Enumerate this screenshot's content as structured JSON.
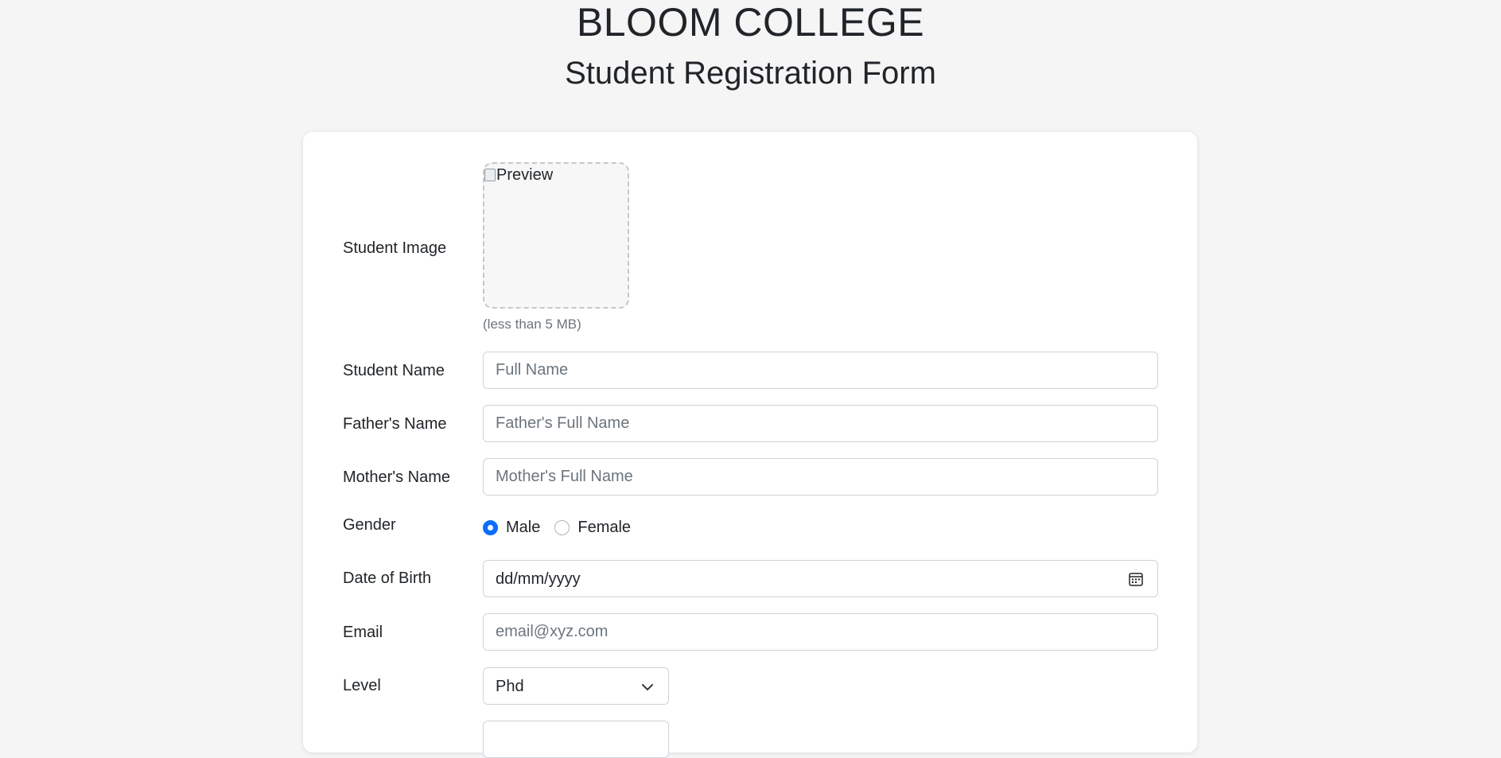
{
  "header": {
    "college": "BLOOM COLLEGE",
    "form_title": "Student Registration Form"
  },
  "form": {
    "image": {
      "label": "Student Image",
      "preview_alt": "Preview",
      "hint": "(less than 5 MB)"
    },
    "student_name": {
      "label": "Student Name",
      "placeholder": "Full Name",
      "value": ""
    },
    "father_name": {
      "label": "Father's Name",
      "placeholder": "Father's Full Name",
      "value": ""
    },
    "mother_name": {
      "label": "Mother's Name",
      "placeholder": "Mother's Full Name",
      "value": ""
    },
    "gender": {
      "label": "Gender",
      "options": [
        {
          "label": "Male",
          "checked": true
        },
        {
          "label": "Female",
          "checked": false
        }
      ]
    },
    "dob": {
      "label": "Date of Birth",
      "value": "dd/mm/yyyy",
      "icon": "calendar-icon"
    },
    "email": {
      "label": "Email",
      "placeholder": "email@xyz.com",
      "value": ""
    },
    "level": {
      "label": "Level",
      "selected": "Phd",
      "icon": "chevron-down-icon"
    }
  },
  "colors": {
    "background": "#f5f5f5",
    "card": "#ffffff",
    "accent": "#0d6efd",
    "placeholder": "#6c757d",
    "border": "#ced4da"
  }
}
